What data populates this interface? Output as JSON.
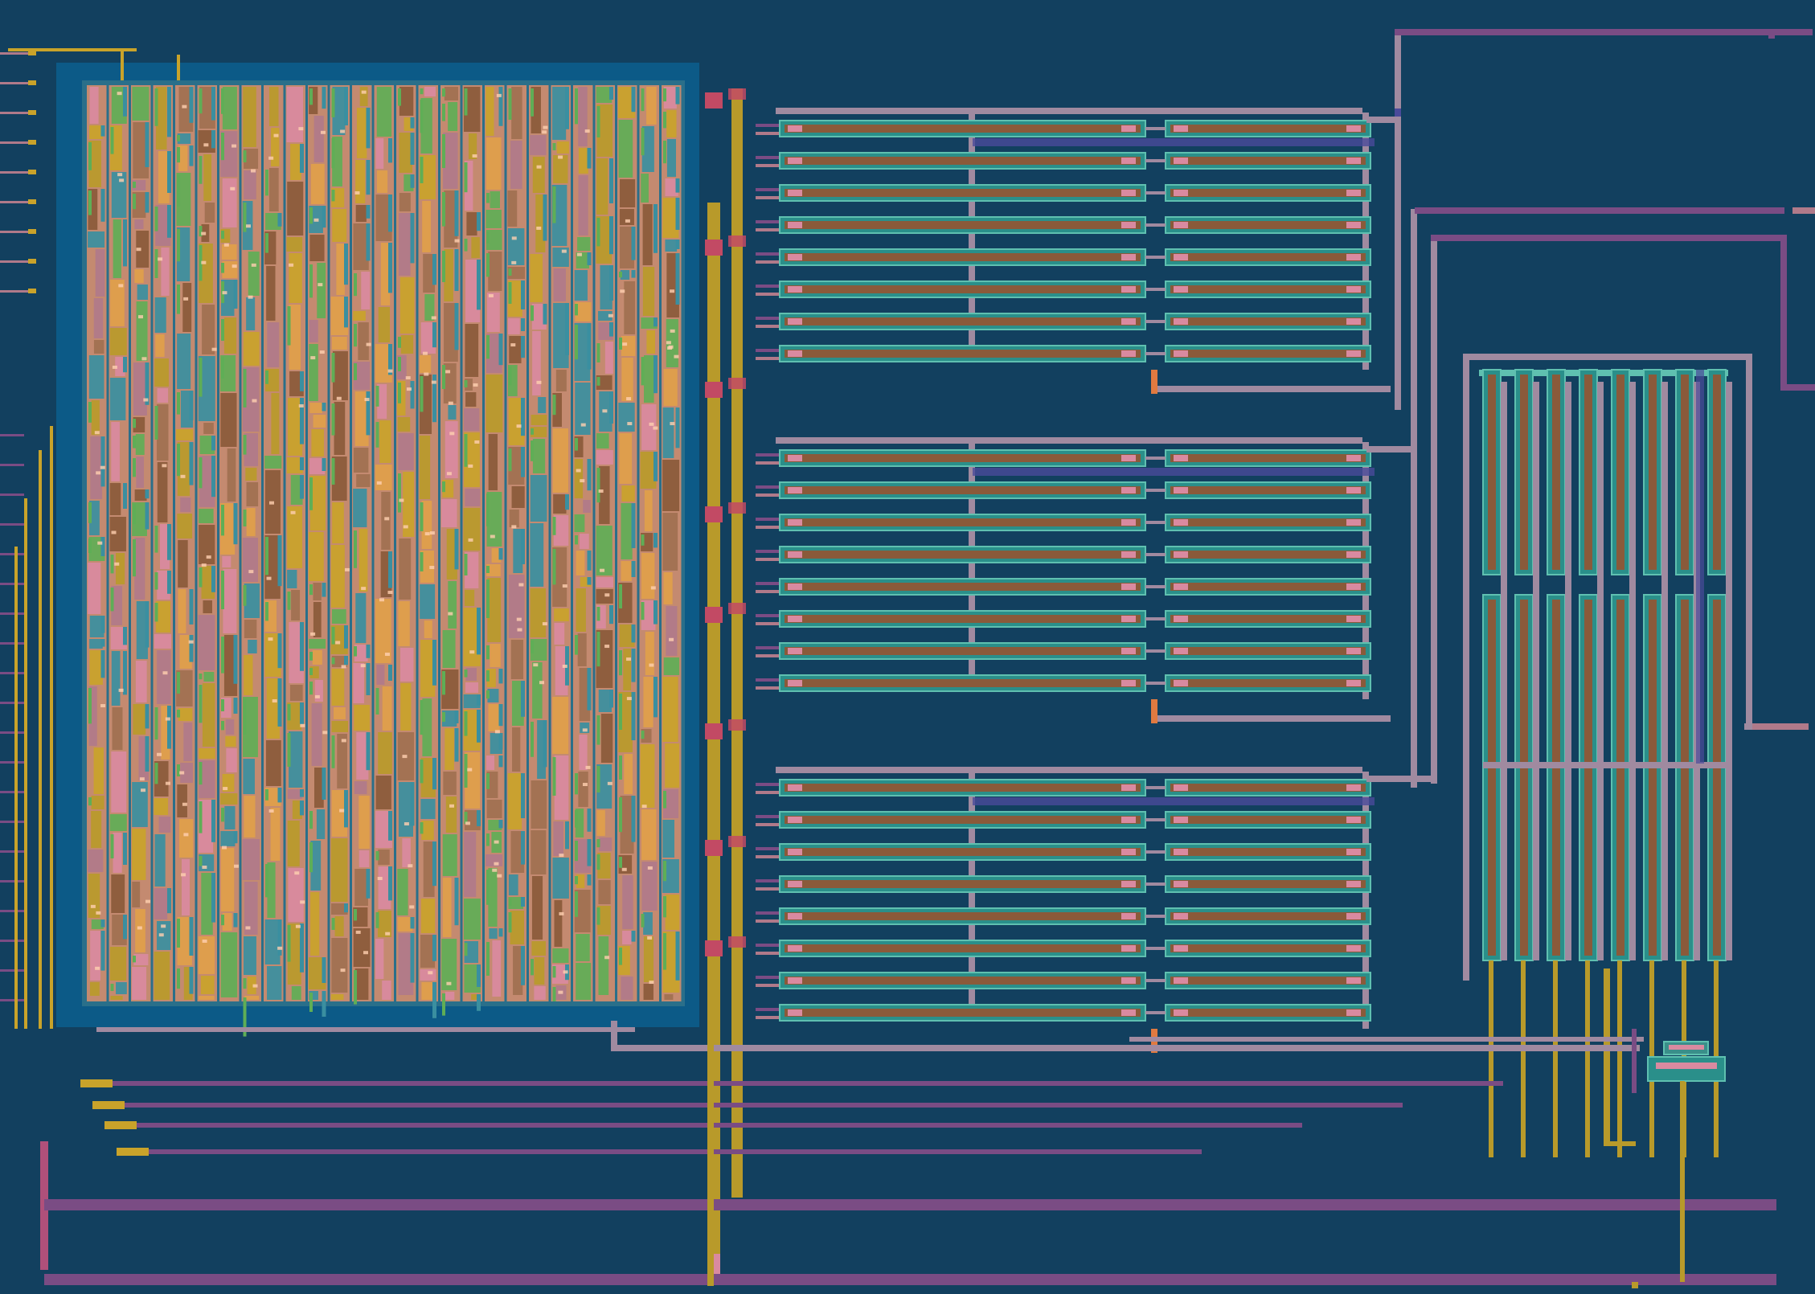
{
  "view": {
    "background": "#12405f"
  },
  "palette": {
    "metal1_purple": "#7a4c84",
    "metal2_pink": "#b07a8a",
    "metal3_gold": "#c9a32a",
    "poly_orange": "#e0a04a",
    "diffusion_green": "#5fae56",
    "nwell_cyan": "#3a8fa0",
    "contact_pink": "#d98aa0",
    "via_red": "#c24a64",
    "resistor_brown": "#8a5a3a",
    "standard_cell_region": "#0c5d8c"
  },
  "icons": {
    "standard_cell_array": "logic-block-icon",
    "resistor_stack": "resistor-icon",
    "capacitor_comb": "capacitor-comb-icon",
    "routing_bus": "wire-bus-icon"
  },
  "blocks": {
    "logic_array": {
      "column_count": 27
    },
    "resistor_banks": [
      {
        "rows": 8
      },
      {
        "rows": 8
      },
      {
        "rows": 8
      }
    ],
    "finger_array": {
      "finger_count": 8
    }
  }
}
